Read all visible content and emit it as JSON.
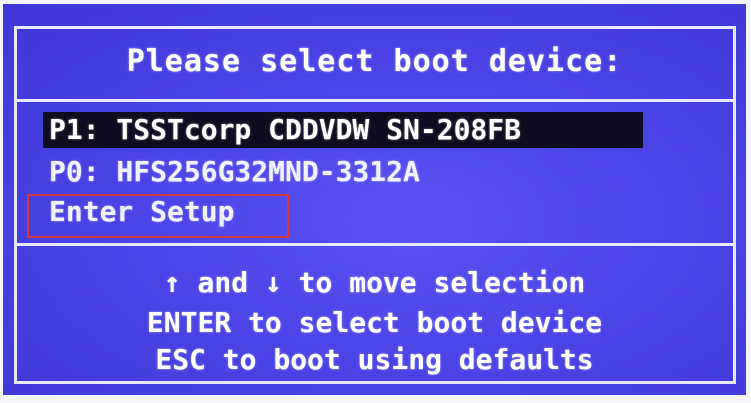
{
  "colors": {
    "screen_background": "#4b44e6",
    "frame_border": "#e8e8ff",
    "selected_background": "#0d0c20",
    "text": "#ffffff",
    "annotation_box": "#d8363b"
  },
  "boot_menu": {
    "title": "Please select boot device:",
    "devices": [
      {
        "label": "P1: TSSTcorp CDDVDW SN-208FB",
        "selected": true
      },
      {
        "label": "P0: HFS256G32MND-3312A",
        "selected": false
      },
      {
        "label": "Enter Setup",
        "selected": false
      }
    ],
    "help": [
      "↑ and ↓ to move selection",
      "ENTER to select boot device",
      "ESC to boot using defaults"
    ]
  }
}
